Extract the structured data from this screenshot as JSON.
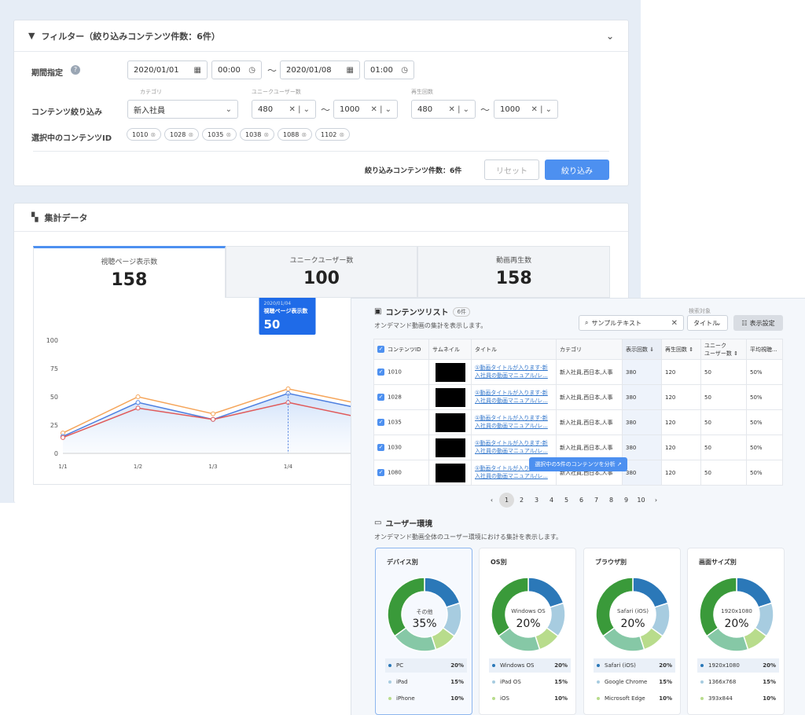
{
  "filter": {
    "title": "フィルター（絞り込みコンテンツ件数：6件）",
    "period_label": "期間指定",
    "date_from": "2020/01/01",
    "time_from": "00:00",
    "date_to": "2020/01/08",
    "time_to": "01:00",
    "tilde": "～",
    "content_label": "コンテンツ絞り込み",
    "category_label": "カテゴリ",
    "category_value": "新入社員",
    "uu_label": "ユニークユーザー数",
    "uu_min": "480",
    "uu_max": "1000",
    "play_label": "再生回数",
    "play_min": "480",
    "play_max": "1000",
    "selected_label": "選択中のコンテンツID",
    "selected_ids": [
      "1010",
      "1028",
      "1035",
      "1038",
      "1088",
      "1102"
    ],
    "count_text": "絞り込みコンテンツ件数：6件",
    "reset_label": "リセット",
    "apply_label": "絞り込み"
  },
  "aggregate": {
    "title": "集計データ",
    "tabs": [
      {
        "label": "視聴ページ表示数",
        "value": "158"
      },
      {
        "label": "ユニークユーザー数",
        "value": "100"
      },
      {
        "label": "動画再生数",
        "value": "158"
      }
    ]
  },
  "chart_data": {
    "type": "area",
    "x": [
      "1/1",
      "1/2",
      "1/3",
      "1/4"
    ],
    "yticks": [
      "100",
      "75",
      "50",
      "25",
      "0"
    ],
    "ylim": [
      0,
      100
    ],
    "series": [
      {
        "color": "#f5a55a",
        "values": [
          18,
          50,
          35,
          57
        ]
      },
      {
        "color": "#4d7fe0",
        "values": [
          15,
          45,
          30,
          53
        ]
      },
      {
        "color": "#e05a5a",
        "values": [
          14,
          40,
          30,
          45
        ]
      }
    ],
    "tooltip": {
      "date": "2020/01/04",
      "label": "視聴ページ表示数",
      "value": "50"
    }
  },
  "content_list": {
    "title": "コンテンツリスト",
    "badge": "6件",
    "desc": "オンデマンド動画の集計を表示します。",
    "search_value": "サンプルテキスト",
    "search_target_label": "検索対象",
    "search_target": "タイトル",
    "settings_label": "表示設定",
    "columns": [
      "コンテンツID",
      "サムネイル",
      "タイトル",
      "カテゴリ",
      "表示回数 ⇓",
      "再生回数 ⇕",
      "ユニーク\nユーザー数 ⇕",
      "平均視聴..."
    ],
    "rows": [
      {
        "id": "1010",
        "title": "①動画タイトルが入ります-新入社員の動画マニュアル/レ...",
        "category": "新入社員,西日本,人事",
        "views": "380",
        "plays": "120",
        "uu": "50",
        "avg": "50%"
      },
      {
        "id": "1028",
        "title": "①動画タイトルが入ります-新入社員の動画マニュアル/レ...",
        "category": "新入社員,西日本,人事",
        "views": "380",
        "plays": "120",
        "uu": "50",
        "avg": "50%"
      },
      {
        "id": "1035",
        "title": "①動画タイトルが入ります-新入社員の動画マニュアル/レ...",
        "category": "新入社員,西日本,人事",
        "views": "380",
        "plays": "120",
        "uu": "50",
        "avg": "50%"
      },
      {
        "id": "1030",
        "title": "①動画タイトルが入ります-新入社員の動画マニュアル/レ...",
        "category": "新入社員,西日本,人事",
        "views": "380",
        "plays": "120",
        "uu": "50",
        "avg": "50%"
      },
      {
        "id": "1080",
        "title": "①動画タイトルが入ります-新入社員の動画マニュアル/レ...",
        "category": "新入社員,西日本,人事",
        "views": "380",
        "plays": "120",
        "uu": "50",
        "avg": "50%"
      }
    ],
    "analyze_button": "選択中の5件のコンテンツを分析 ↗",
    "pages": [
      "‹",
      "1",
      "2",
      "3",
      "4",
      "5",
      "6",
      "7",
      "8",
      "9",
      "10",
      "›"
    ]
  },
  "user_env": {
    "title": "ユーザー環境",
    "desc": "オンデマンド動画全体のユーザー環境における集計を表示します。",
    "cards": [
      {
        "title": "デバイス別",
        "center_label": "その他",
        "center_value": "35%",
        "legend": [
          {
            "name": "PC",
            "value": "20%"
          },
          {
            "name": "iPad",
            "value": "15%"
          },
          {
            "name": "iPhone",
            "value": "10%"
          }
        ]
      },
      {
        "title": "OS別",
        "center_label": "Windows OS",
        "center_value": "20%",
        "legend": [
          {
            "name": "Windows OS",
            "value": "20%"
          },
          {
            "name": "iPad OS",
            "value": "15%"
          },
          {
            "name": "iOS",
            "value": "10%"
          }
        ]
      },
      {
        "title": "ブラウザ別",
        "center_label": "Safari (iOS)",
        "center_value": "20%",
        "legend": [
          {
            "name": "Safari (iOS)",
            "value": "20%"
          },
          {
            "name": "Google Chrome",
            "value": "15%"
          },
          {
            "name": "Microsoft Edge",
            "value": "10%"
          }
        ]
      },
      {
        "title": "画面サイズ別",
        "center_label": "1920x1080",
        "center_value": "20%",
        "legend": [
          {
            "name": "1920x1080",
            "value": "20%"
          },
          {
            "name": "1366x768",
            "value": "15%"
          },
          {
            "name": "393x844",
            "value": "10%"
          }
        ]
      }
    ],
    "donut": [
      {
        "value": 20,
        "color": "#2b78b8"
      },
      {
        "value": 15,
        "color": "#a7cce0"
      },
      {
        "value": 10,
        "color": "#b8dc8c"
      },
      {
        "value": 20,
        "color": "#86c8a6"
      },
      {
        "value": 35,
        "color": "#3a9a3a"
      }
    ]
  }
}
